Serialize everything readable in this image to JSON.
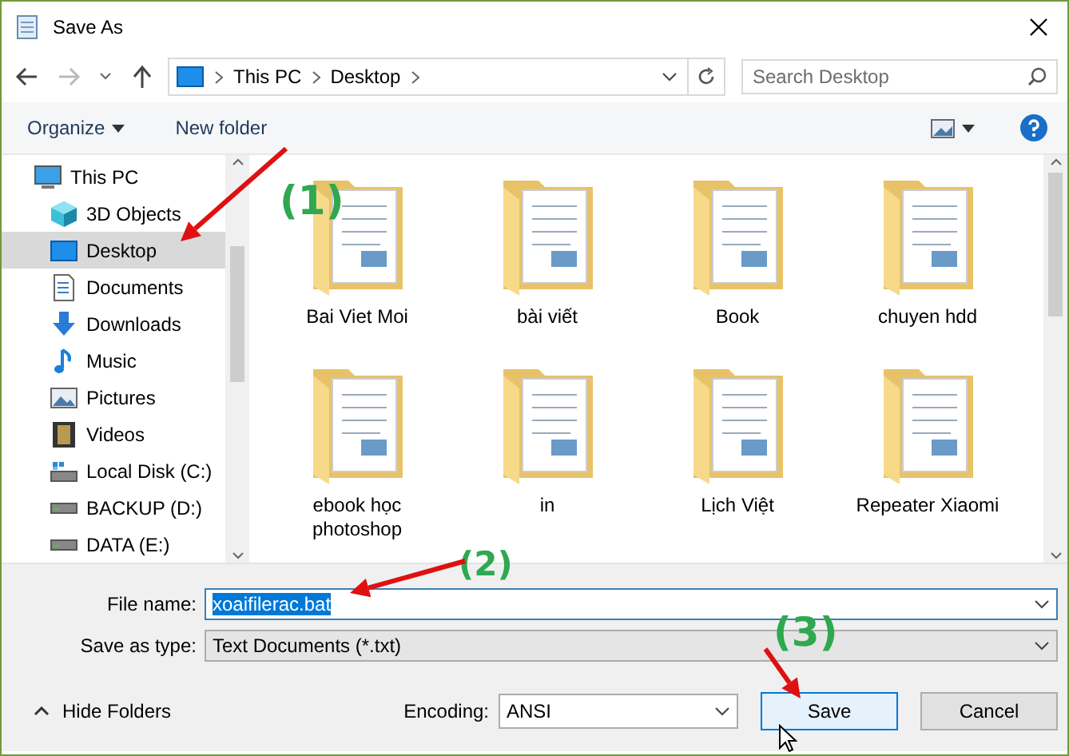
{
  "window": {
    "title": "Save As"
  },
  "address": {
    "crumbs": [
      "This PC",
      "Desktop"
    ]
  },
  "search": {
    "placeholder": "Search Desktop"
  },
  "toolbar": [
    {
      "label": "Organize",
      "kind": "menu"
    },
    {
      "label": "New folder",
      "kind": "button"
    }
  ],
  "nav_pane": [
    {
      "label": "This PC",
      "kind": "pc",
      "selected": false,
      "children": [
        {
          "label": "3D Objects",
          "kind": "cube",
          "selected": false
        },
        {
          "label": "Desktop",
          "kind": "desktop",
          "selected": true
        },
        {
          "label": "Documents",
          "kind": "documents",
          "selected": false
        },
        {
          "label": "Downloads",
          "kind": "downloads",
          "selected": false
        },
        {
          "label": "Music",
          "kind": "music",
          "selected": false
        },
        {
          "label": "Pictures",
          "kind": "pictures",
          "selected": false
        },
        {
          "label": "Videos",
          "kind": "videos",
          "selected": false
        },
        {
          "label": "Local Disk (C:)",
          "kind": "disk",
          "selected": false
        },
        {
          "label": "BACKUP (D:)",
          "kind": "drive",
          "selected": false
        },
        {
          "label": "DATA (E:)",
          "kind": "drive",
          "selected": false
        }
      ]
    }
  ],
  "folders": [
    "Bai Viet Moi",
    "bài viết",
    "Book",
    "chuyen hdd",
    "ebook học photoshop",
    "in",
    "Lịch Việt",
    "Repeater Xiaomi"
  ],
  "file_name": {
    "label": "File name:",
    "value": "xoaifilerac.bat",
    "text_selected": true
  },
  "save_as_type": {
    "label": "Save as type:",
    "value": "Text Documents (*.txt)"
  },
  "hide_folders": "Hide Folders",
  "encoding": {
    "label": "Encoding:",
    "value": "ANSI"
  },
  "buttons": [
    {
      "label": "Save",
      "focused": true
    },
    {
      "label": "Cancel",
      "focused": false
    }
  ],
  "annotations": [
    "(1)",
    "(2)",
    "(3)"
  ]
}
